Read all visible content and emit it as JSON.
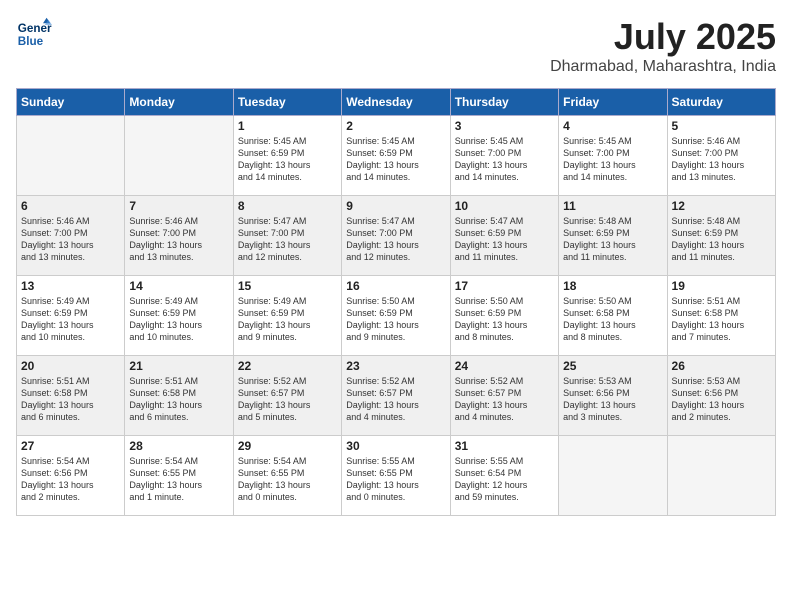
{
  "header": {
    "logo_line1": "General",
    "logo_line2": "Blue",
    "month_year": "July 2025",
    "location": "Dharmabad, Maharashtra, India"
  },
  "days_of_week": [
    "Sunday",
    "Monday",
    "Tuesday",
    "Wednesday",
    "Thursday",
    "Friday",
    "Saturday"
  ],
  "weeks": [
    [
      {
        "day": "",
        "info": ""
      },
      {
        "day": "",
        "info": ""
      },
      {
        "day": "1",
        "info": "Sunrise: 5:45 AM\nSunset: 6:59 PM\nDaylight: 13 hours\nand 14 minutes."
      },
      {
        "day": "2",
        "info": "Sunrise: 5:45 AM\nSunset: 6:59 PM\nDaylight: 13 hours\nand 14 minutes."
      },
      {
        "day": "3",
        "info": "Sunrise: 5:45 AM\nSunset: 7:00 PM\nDaylight: 13 hours\nand 14 minutes."
      },
      {
        "day": "4",
        "info": "Sunrise: 5:45 AM\nSunset: 7:00 PM\nDaylight: 13 hours\nand 14 minutes."
      },
      {
        "day": "5",
        "info": "Sunrise: 5:46 AM\nSunset: 7:00 PM\nDaylight: 13 hours\nand 13 minutes."
      }
    ],
    [
      {
        "day": "6",
        "info": "Sunrise: 5:46 AM\nSunset: 7:00 PM\nDaylight: 13 hours\nand 13 minutes."
      },
      {
        "day": "7",
        "info": "Sunrise: 5:46 AM\nSunset: 7:00 PM\nDaylight: 13 hours\nand 13 minutes."
      },
      {
        "day": "8",
        "info": "Sunrise: 5:47 AM\nSunset: 7:00 PM\nDaylight: 13 hours\nand 12 minutes."
      },
      {
        "day": "9",
        "info": "Sunrise: 5:47 AM\nSunset: 7:00 PM\nDaylight: 13 hours\nand 12 minutes."
      },
      {
        "day": "10",
        "info": "Sunrise: 5:47 AM\nSunset: 6:59 PM\nDaylight: 13 hours\nand 11 minutes."
      },
      {
        "day": "11",
        "info": "Sunrise: 5:48 AM\nSunset: 6:59 PM\nDaylight: 13 hours\nand 11 minutes."
      },
      {
        "day": "12",
        "info": "Sunrise: 5:48 AM\nSunset: 6:59 PM\nDaylight: 13 hours\nand 11 minutes."
      }
    ],
    [
      {
        "day": "13",
        "info": "Sunrise: 5:49 AM\nSunset: 6:59 PM\nDaylight: 13 hours\nand 10 minutes."
      },
      {
        "day": "14",
        "info": "Sunrise: 5:49 AM\nSunset: 6:59 PM\nDaylight: 13 hours\nand 10 minutes."
      },
      {
        "day": "15",
        "info": "Sunrise: 5:49 AM\nSunset: 6:59 PM\nDaylight: 13 hours\nand 9 minutes."
      },
      {
        "day": "16",
        "info": "Sunrise: 5:50 AM\nSunset: 6:59 PM\nDaylight: 13 hours\nand 9 minutes."
      },
      {
        "day": "17",
        "info": "Sunrise: 5:50 AM\nSunset: 6:59 PM\nDaylight: 13 hours\nand 8 minutes."
      },
      {
        "day": "18",
        "info": "Sunrise: 5:50 AM\nSunset: 6:58 PM\nDaylight: 13 hours\nand 8 minutes."
      },
      {
        "day": "19",
        "info": "Sunrise: 5:51 AM\nSunset: 6:58 PM\nDaylight: 13 hours\nand 7 minutes."
      }
    ],
    [
      {
        "day": "20",
        "info": "Sunrise: 5:51 AM\nSunset: 6:58 PM\nDaylight: 13 hours\nand 6 minutes."
      },
      {
        "day": "21",
        "info": "Sunrise: 5:51 AM\nSunset: 6:58 PM\nDaylight: 13 hours\nand 6 minutes."
      },
      {
        "day": "22",
        "info": "Sunrise: 5:52 AM\nSunset: 6:57 PM\nDaylight: 13 hours\nand 5 minutes."
      },
      {
        "day": "23",
        "info": "Sunrise: 5:52 AM\nSunset: 6:57 PM\nDaylight: 13 hours\nand 4 minutes."
      },
      {
        "day": "24",
        "info": "Sunrise: 5:52 AM\nSunset: 6:57 PM\nDaylight: 13 hours\nand 4 minutes."
      },
      {
        "day": "25",
        "info": "Sunrise: 5:53 AM\nSunset: 6:56 PM\nDaylight: 13 hours\nand 3 minutes."
      },
      {
        "day": "26",
        "info": "Sunrise: 5:53 AM\nSunset: 6:56 PM\nDaylight: 13 hours\nand 2 minutes."
      }
    ],
    [
      {
        "day": "27",
        "info": "Sunrise: 5:54 AM\nSunset: 6:56 PM\nDaylight: 13 hours\nand 2 minutes."
      },
      {
        "day": "28",
        "info": "Sunrise: 5:54 AM\nSunset: 6:55 PM\nDaylight: 13 hours\nand 1 minute."
      },
      {
        "day": "29",
        "info": "Sunrise: 5:54 AM\nSunset: 6:55 PM\nDaylight: 13 hours\nand 0 minutes."
      },
      {
        "day": "30",
        "info": "Sunrise: 5:55 AM\nSunset: 6:55 PM\nDaylight: 13 hours\nand 0 minutes."
      },
      {
        "day": "31",
        "info": "Sunrise: 5:55 AM\nSunset: 6:54 PM\nDaylight: 12 hours\nand 59 minutes."
      },
      {
        "day": "",
        "info": ""
      },
      {
        "day": "",
        "info": ""
      }
    ]
  ]
}
